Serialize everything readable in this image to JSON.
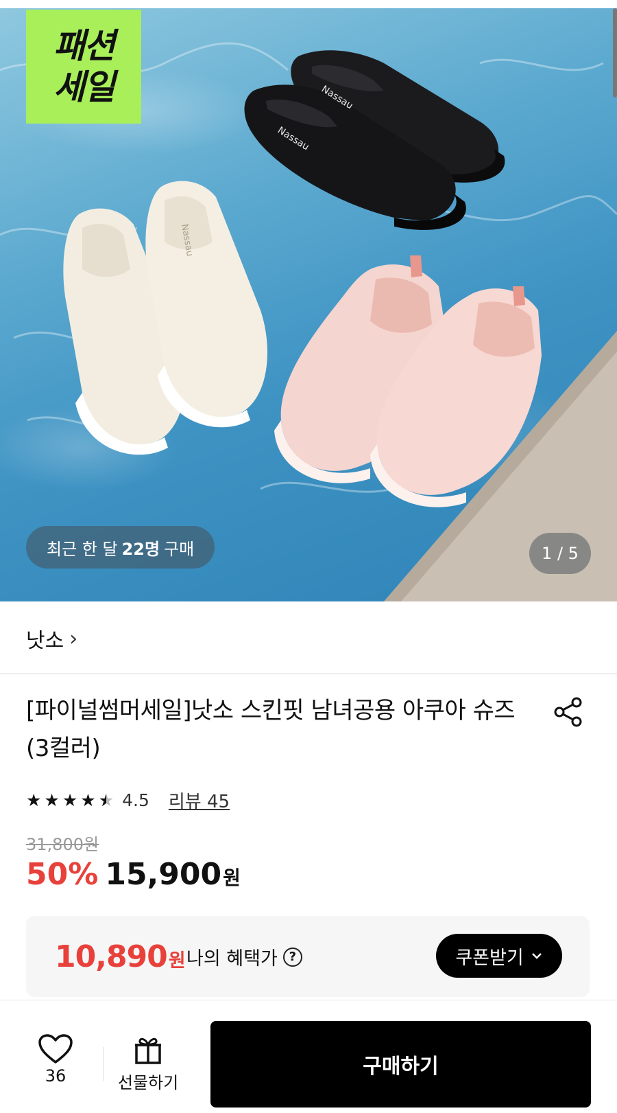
{
  "hero": {
    "sale_tag_line1": "패션",
    "sale_tag_line2": "세일",
    "buyers_prefix": "최근 한 달",
    "buyers_count": "22명",
    "buyers_suffix": "구매",
    "page_indicator": "1 / 5",
    "shoe_brand_text": "Nassau"
  },
  "brand": {
    "name": "낫소",
    "chevron": "›"
  },
  "product": {
    "title": "[파이널썸머세일]낫소 스킨핏 남녀공용 아쿠아 슈즈(3컬러)",
    "rating": 4.5,
    "rating_text": "4.5",
    "review_link": "리뷰 45",
    "original_price": "31,800원",
    "discount": "50%",
    "price": "15,900",
    "price_unit": "원"
  },
  "benefit": {
    "price": "10,890",
    "unit": "원",
    "label": "나의 혜택가",
    "help_icon": "question-circle-icon",
    "coupon_button": "쿠폰받기"
  },
  "bottom_bar": {
    "like_count": "36",
    "gift_label": "선물하기",
    "buy_label": "구매하기"
  },
  "colors": {
    "accent_red": "#e8413b",
    "sale_green": "#a8ef5a",
    "button_black": "#000000"
  }
}
